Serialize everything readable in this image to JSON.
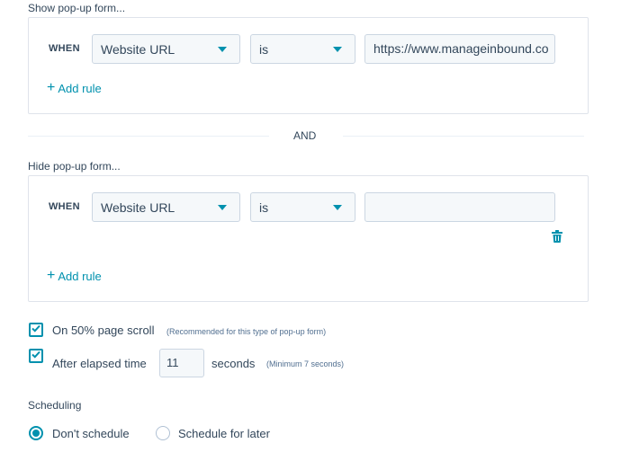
{
  "show_section": {
    "title": "Show pop-up form...",
    "when_label": "WHEN",
    "field_select": "Website URL",
    "operator_select": "is",
    "value_input": "https://www.manageinbound.co",
    "add_rule": "Add rule"
  },
  "and_label": "AND",
  "hide_section": {
    "title": "Hide pop-up form...",
    "when_label": "WHEN",
    "field_select": "Website URL",
    "operator_select": "is",
    "value_input": "",
    "add_rule": "Add rule"
  },
  "triggers": {
    "scroll": {
      "label": "On 50% page scroll",
      "note": "(Recommended for this type of pop-up form)",
      "checked": true
    },
    "elapsed": {
      "label": "After elapsed time",
      "value": "11",
      "unit": "seconds",
      "note": "(Minimum 7 seconds)",
      "checked": true
    }
  },
  "scheduling": {
    "title": "Scheduling",
    "options": [
      {
        "label": "Don't schedule",
        "selected": true
      },
      {
        "label": "Schedule for later",
        "selected": false
      }
    ]
  },
  "colors": {
    "accent": "#0091ae",
    "text": "#33475b",
    "border": "#cbd6e2",
    "input_bg": "#f5f8fa"
  }
}
